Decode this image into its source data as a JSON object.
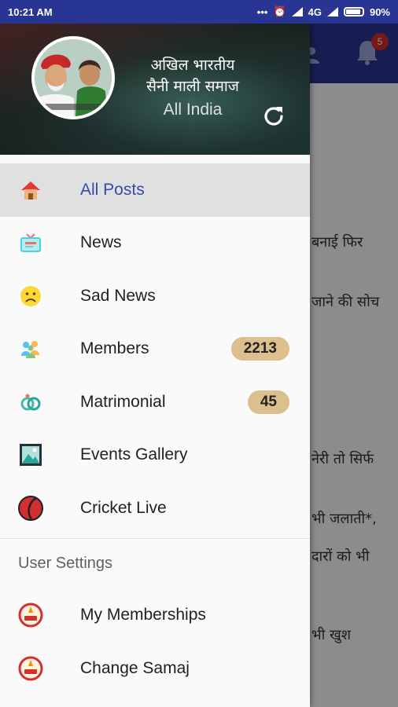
{
  "status_bar": {
    "time": "10:21 AM",
    "network": "4G",
    "battery": "90%"
  },
  "background": {
    "notification_count": "5",
    "text_lines": [
      "बनाई फिर",
      "जाने की सोच",
      "नेरी तो सिर्फ",
      "भी जलाती*,",
      "दारों को भी",
      "भी खुश"
    ]
  },
  "drawer": {
    "title": "अखिल भारतीय\nसैनी माली समाज",
    "subtitle": "All India",
    "items": [
      {
        "label": "All Posts",
        "icon": "home-icon"
      },
      {
        "label": "News",
        "icon": "tv-icon"
      },
      {
        "label": "Sad News",
        "icon": "sad-face-icon"
      },
      {
        "label": "Members",
        "icon": "people-icon",
        "badge": "2213"
      },
      {
        "label": "Matrimonial",
        "icon": "rings-icon",
        "badge": "45"
      },
      {
        "label": "Events Gallery",
        "icon": "gallery-icon"
      },
      {
        "label": "Cricket Live",
        "icon": "cricket-ball-icon"
      }
    ],
    "section_title": "User Settings",
    "settings_items": [
      {
        "label": "My Memberships",
        "icon": "samaj-logo-icon"
      },
      {
        "label": "Change Samaj",
        "icon": "samaj-logo-icon"
      }
    ]
  },
  "colors": {
    "primary": "#283593",
    "active_text": "#3949ab",
    "badge_bg": "#dcbf8e",
    "active_bg": "#e0e0e0"
  }
}
